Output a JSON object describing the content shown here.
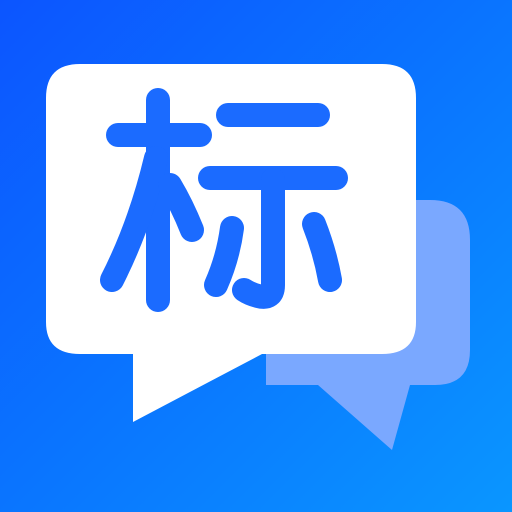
{
  "app_icon": {
    "glyph": "标",
    "colors": {
      "background_top": "#0c5bff",
      "background_bottom": "#0a8cff",
      "front_bubble": "#ffffff",
      "back_bubble": "#7aa8ff",
      "glyph": "#1b6bff"
    },
    "icons": [
      "front-speech-bubble-icon",
      "back-speech-bubble-icon"
    ]
  }
}
